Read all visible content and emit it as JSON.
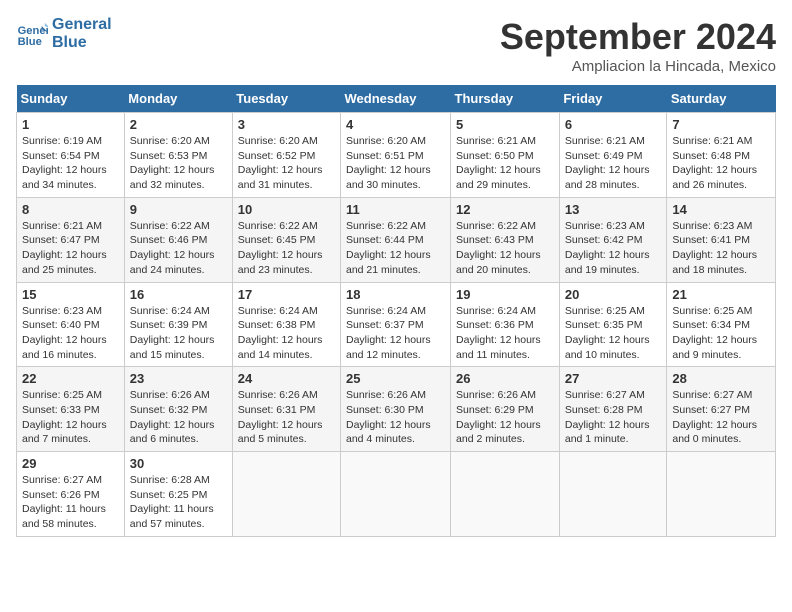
{
  "header": {
    "logo_line1": "General",
    "logo_line2": "Blue",
    "month": "September 2024",
    "location": "Ampliacion la Hincada, Mexico"
  },
  "days_of_week": [
    "Sunday",
    "Monday",
    "Tuesday",
    "Wednesday",
    "Thursday",
    "Friday",
    "Saturday"
  ],
  "weeks": [
    [
      {
        "day": "1",
        "sunrise": "6:19 AM",
        "sunset": "6:54 PM",
        "daylight": "12 hours and 34 minutes."
      },
      {
        "day": "2",
        "sunrise": "6:20 AM",
        "sunset": "6:53 PM",
        "daylight": "12 hours and 32 minutes."
      },
      {
        "day": "3",
        "sunrise": "6:20 AM",
        "sunset": "6:52 PM",
        "daylight": "12 hours and 31 minutes."
      },
      {
        "day": "4",
        "sunrise": "6:20 AM",
        "sunset": "6:51 PM",
        "daylight": "12 hours and 30 minutes."
      },
      {
        "day": "5",
        "sunrise": "6:21 AM",
        "sunset": "6:50 PM",
        "daylight": "12 hours and 29 minutes."
      },
      {
        "day": "6",
        "sunrise": "6:21 AM",
        "sunset": "6:49 PM",
        "daylight": "12 hours and 28 minutes."
      },
      {
        "day": "7",
        "sunrise": "6:21 AM",
        "sunset": "6:48 PM",
        "daylight": "12 hours and 26 minutes."
      }
    ],
    [
      {
        "day": "8",
        "sunrise": "6:21 AM",
        "sunset": "6:47 PM",
        "daylight": "12 hours and 25 minutes."
      },
      {
        "day": "9",
        "sunrise": "6:22 AM",
        "sunset": "6:46 PM",
        "daylight": "12 hours and 24 minutes."
      },
      {
        "day": "10",
        "sunrise": "6:22 AM",
        "sunset": "6:45 PM",
        "daylight": "12 hours and 23 minutes."
      },
      {
        "day": "11",
        "sunrise": "6:22 AM",
        "sunset": "6:44 PM",
        "daylight": "12 hours and 21 minutes."
      },
      {
        "day": "12",
        "sunrise": "6:22 AM",
        "sunset": "6:43 PM",
        "daylight": "12 hours and 20 minutes."
      },
      {
        "day": "13",
        "sunrise": "6:23 AM",
        "sunset": "6:42 PM",
        "daylight": "12 hours and 19 minutes."
      },
      {
        "day": "14",
        "sunrise": "6:23 AM",
        "sunset": "6:41 PM",
        "daylight": "12 hours and 18 minutes."
      }
    ],
    [
      {
        "day": "15",
        "sunrise": "6:23 AM",
        "sunset": "6:40 PM",
        "daylight": "12 hours and 16 minutes."
      },
      {
        "day": "16",
        "sunrise": "6:24 AM",
        "sunset": "6:39 PM",
        "daylight": "12 hours and 15 minutes."
      },
      {
        "day": "17",
        "sunrise": "6:24 AM",
        "sunset": "6:38 PM",
        "daylight": "12 hours and 14 minutes."
      },
      {
        "day": "18",
        "sunrise": "6:24 AM",
        "sunset": "6:37 PM",
        "daylight": "12 hours and 12 minutes."
      },
      {
        "day": "19",
        "sunrise": "6:24 AM",
        "sunset": "6:36 PM",
        "daylight": "12 hours and 11 minutes."
      },
      {
        "day": "20",
        "sunrise": "6:25 AM",
        "sunset": "6:35 PM",
        "daylight": "12 hours and 10 minutes."
      },
      {
        "day": "21",
        "sunrise": "6:25 AM",
        "sunset": "6:34 PM",
        "daylight": "12 hours and 9 minutes."
      }
    ],
    [
      {
        "day": "22",
        "sunrise": "6:25 AM",
        "sunset": "6:33 PM",
        "daylight": "12 hours and 7 minutes."
      },
      {
        "day": "23",
        "sunrise": "6:26 AM",
        "sunset": "6:32 PM",
        "daylight": "12 hours and 6 minutes."
      },
      {
        "day": "24",
        "sunrise": "6:26 AM",
        "sunset": "6:31 PM",
        "daylight": "12 hours and 5 minutes."
      },
      {
        "day": "25",
        "sunrise": "6:26 AM",
        "sunset": "6:30 PM",
        "daylight": "12 hours and 4 minutes."
      },
      {
        "day": "26",
        "sunrise": "6:26 AM",
        "sunset": "6:29 PM",
        "daylight": "12 hours and 2 minutes."
      },
      {
        "day": "27",
        "sunrise": "6:27 AM",
        "sunset": "6:28 PM",
        "daylight": "12 hours and 1 minute."
      },
      {
        "day": "28",
        "sunrise": "6:27 AM",
        "sunset": "6:27 PM",
        "daylight": "12 hours and 0 minutes."
      }
    ],
    [
      {
        "day": "29",
        "sunrise": "6:27 AM",
        "sunset": "6:26 PM",
        "daylight": "11 hours and 58 minutes."
      },
      {
        "day": "30",
        "sunrise": "6:28 AM",
        "sunset": "6:25 PM",
        "daylight": "11 hours and 57 minutes."
      },
      null,
      null,
      null,
      null,
      null
    ]
  ]
}
